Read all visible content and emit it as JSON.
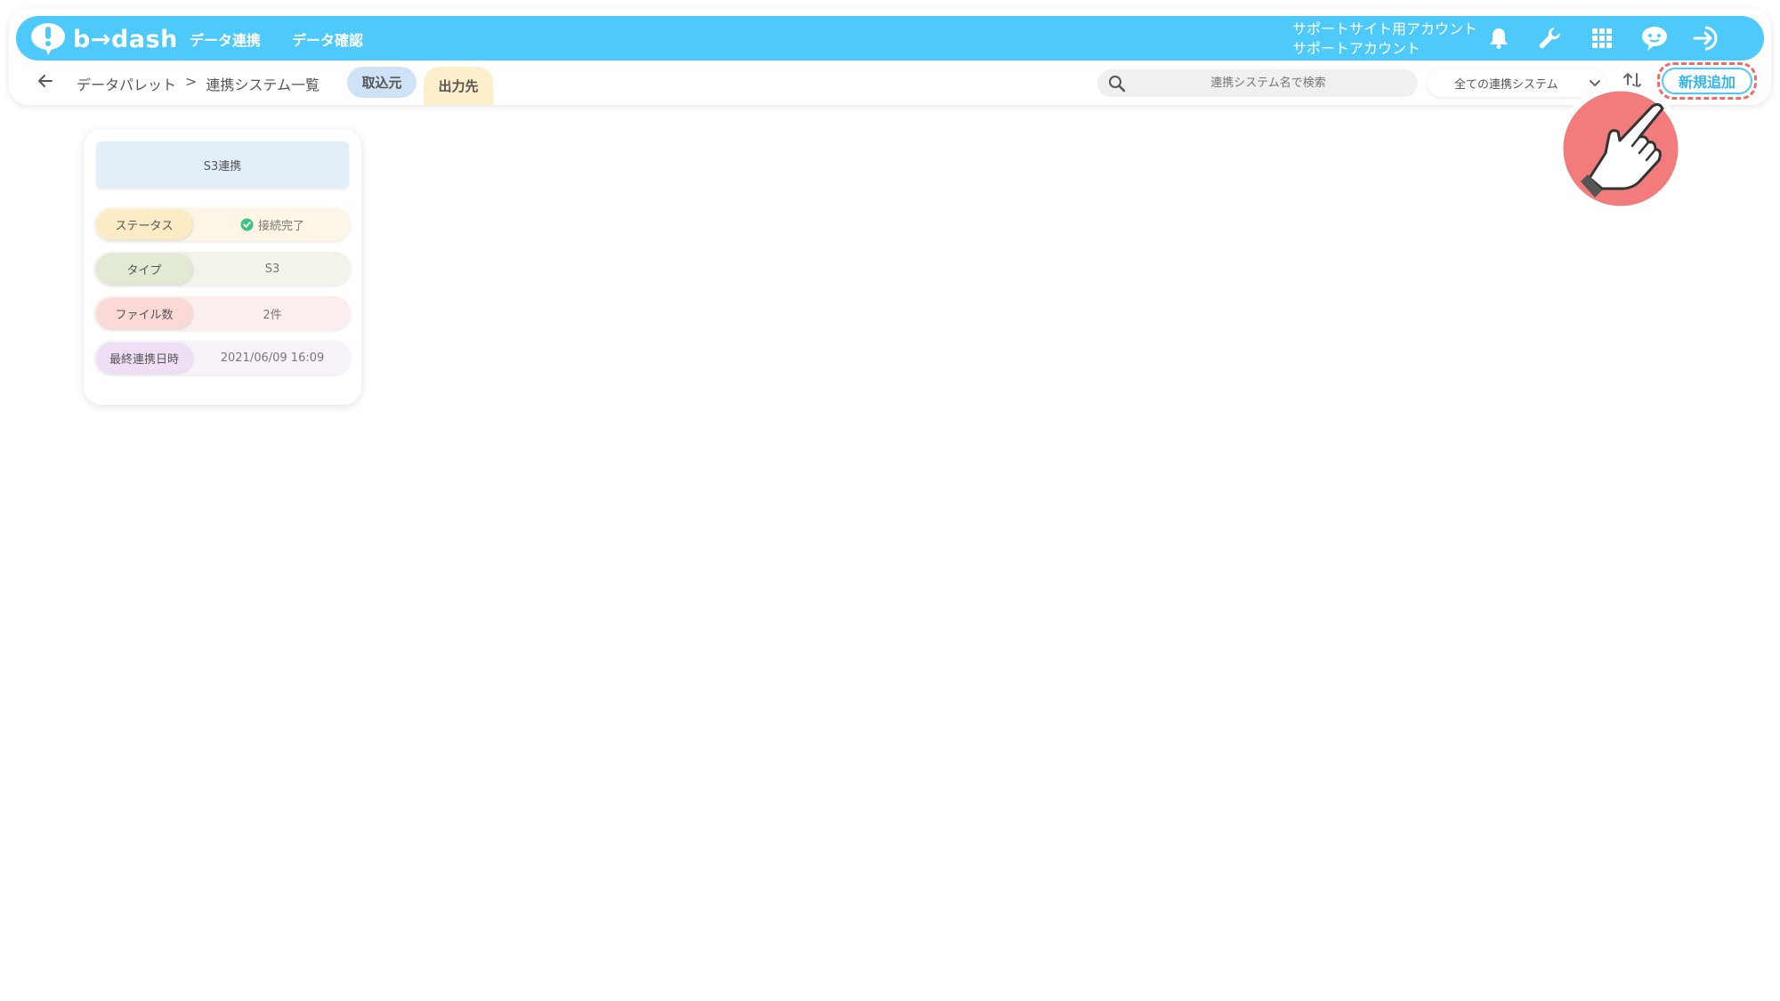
{
  "header": {
    "logo_text": "b→dash",
    "nav": [
      "データ連携",
      "データ確認"
    ],
    "account_line1": "サポートサイト用アカウント",
    "account_line2": "サポートアカウント",
    "icons": [
      "bell-icon",
      "wrench-icon",
      "apps-grid-icon",
      "chat-bot-icon",
      "logout-icon"
    ],
    "accent_color": "#4ec9fb"
  },
  "toolbar": {
    "breadcrumb_root": "データパレット",
    "breadcrumb_sep": ">",
    "breadcrumb_current": "連携システム一覧",
    "tab_import": "取込元",
    "tab_export": "出力先",
    "search_placeholder": "連携システム名で検索",
    "filter_selected": "全ての連携システム",
    "add_button": "新規追加"
  },
  "cards": [
    {
      "title": "S3連携",
      "status_label": "ステータス",
      "status_value": "接続完了",
      "type_label": "タイプ",
      "type_value": "S3",
      "files_label": "ファイル数",
      "files_value": "2件",
      "date_label": "最終連携日時",
      "date_value": "2021/06/09 16:09"
    }
  ],
  "annotation": {
    "highlight_color": "#ef6b6b"
  }
}
